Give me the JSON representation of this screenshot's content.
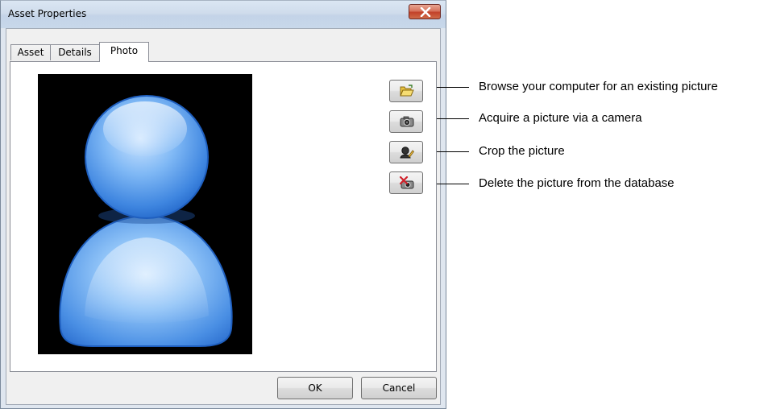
{
  "window": {
    "title": "Asset Properties"
  },
  "tabs": [
    {
      "label": "Asset",
      "active": false
    },
    {
      "label": "Details",
      "active": false
    },
    {
      "label": "Photo",
      "active": true
    }
  ],
  "photo": {
    "subject": "user-silhouette-icon",
    "background_color": "#000000",
    "figure_color": "#5aa3ef"
  },
  "side_buttons": [
    {
      "icon": "folder-open-icon"
    },
    {
      "icon": "camera-icon"
    },
    {
      "icon": "crop-icon"
    },
    {
      "icon": "delete-photo-icon"
    }
  ],
  "callouts": [
    "Browse your computer for an existing picture",
    "Acquire a picture via a camera",
    "Crop the picture",
    "Delete the picture from the database"
  ],
  "buttons": {
    "ok_label": "OK",
    "cancel_label": "Cancel"
  },
  "colors": {
    "close_button": "#c2422a",
    "window_frame": "#dfe6ef"
  }
}
